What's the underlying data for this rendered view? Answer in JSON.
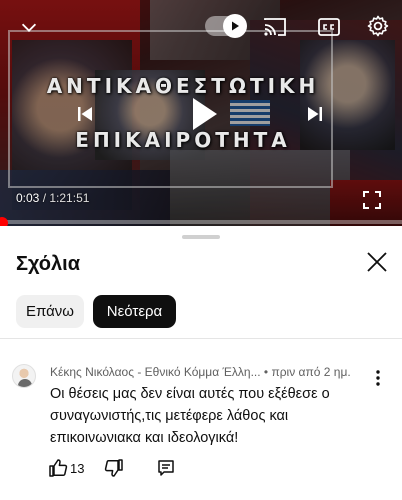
{
  "player": {
    "title_line_1": "ΑΝΤΙΚΑΘΕΣΤΩΤΙΚΗ",
    "title_line_2": "ΕΠΙΚΑΙΡΟΤΗΤΑ",
    "current_time": "0:03",
    "separator": " / ",
    "duration": "1:21:51",
    "progress_fraction": 0.0006,
    "icons": {
      "minimize": "chevron-down-icon",
      "autoplay": "autoplay-toggle-icon",
      "cast": "cast-icon",
      "captions": "closed-captions-icon",
      "settings": "gear-icon",
      "previous": "skip-previous-icon",
      "play": "play-icon",
      "next": "skip-next-icon",
      "fullscreen": "fullscreen-icon"
    },
    "accent_color": "#ff0000"
  },
  "comments": {
    "title": "Σχόλια",
    "close_icon": "close-icon",
    "sort_chips": [
      {
        "label": "Επάνω",
        "selected": false
      },
      {
        "label": "Νεότερα",
        "selected": true
      }
    ],
    "items": [
      {
        "author": "Κέκης Νικόλαος - Εθνικό Κόμμα Έλλη...",
        "time": " • πριν από 2 ημ.",
        "text": "Οι θέσεις μας δεν είναι αυτές που εξέθεσε ο συναγωνιστής,τις μετέφερε λάθος και επικοινωνιακα και ιδεολογικά!",
        "likes": "13"
      }
    ]
  }
}
